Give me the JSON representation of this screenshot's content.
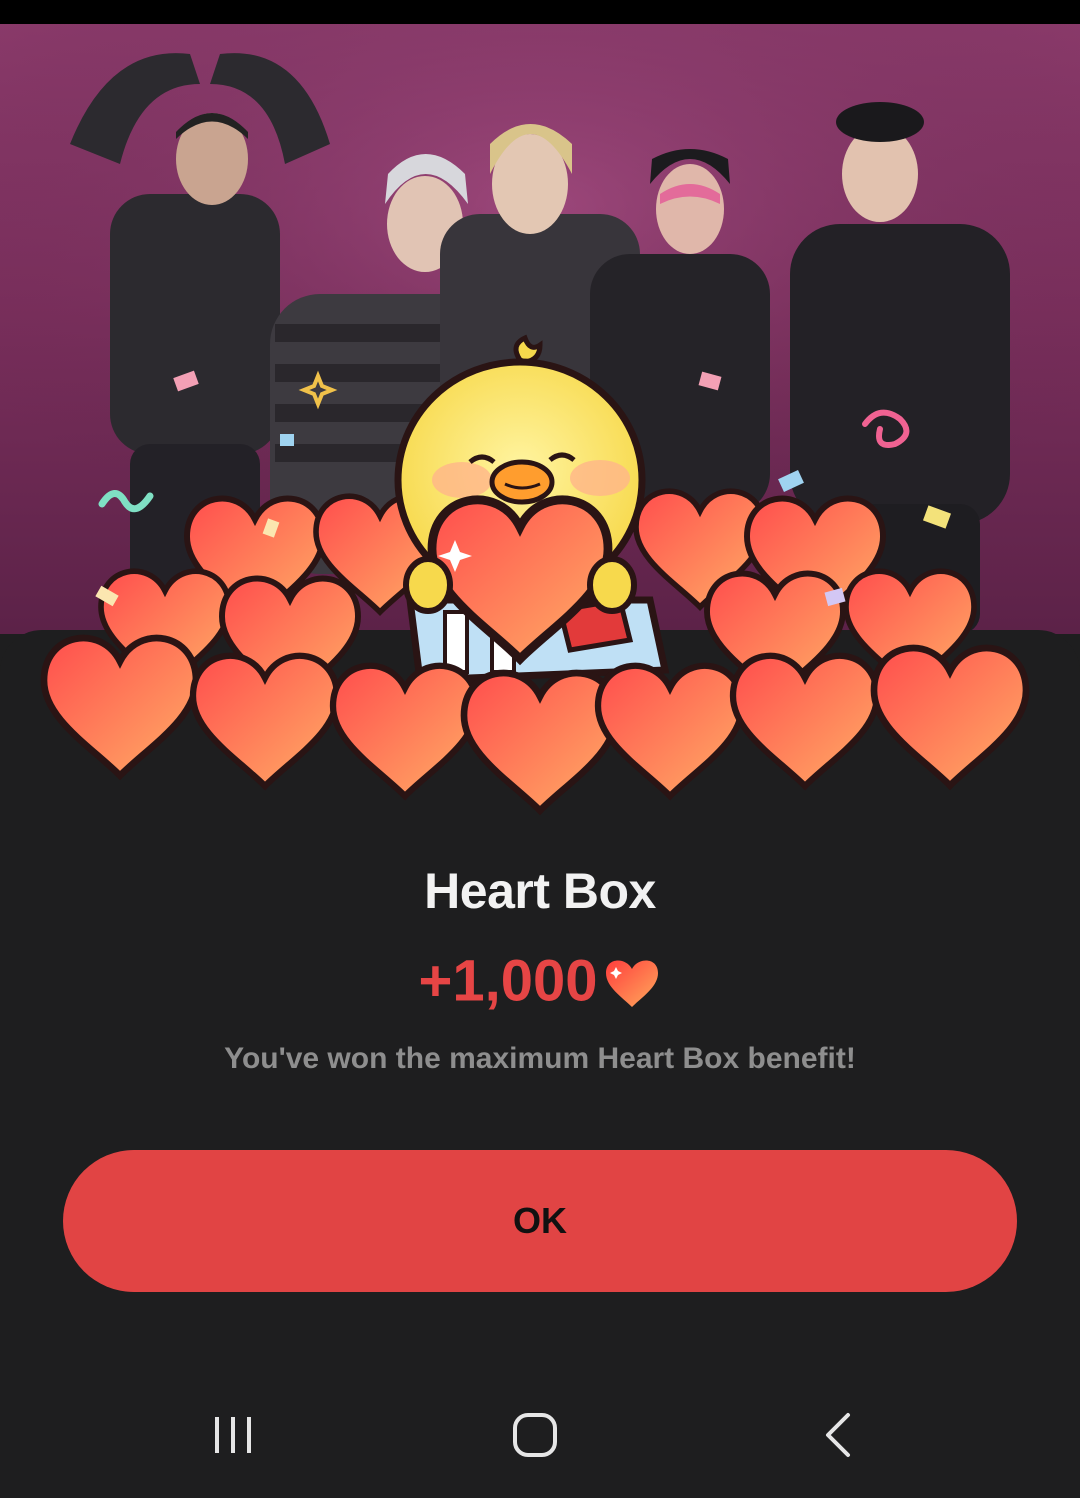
{
  "dialog": {
    "title": "Heart Box",
    "reward_amount": "+1,000",
    "reward_icon": "heart-icon",
    "message": "You've won the maximum Heart Box benefit!",
    "ok_label": "OK"
  },
  "colors": {
    "accent": "#e14444",
    "reward_text": "#e64545",
    "sheet_background": "#1e1e1f",
    "banner_background": "#7a2f5c"
  },
  "navigation_bar": {
    "icons": [
      "recent-apps-icon",
      "home-icon",
      "back-icon"
    ]
  }
}
